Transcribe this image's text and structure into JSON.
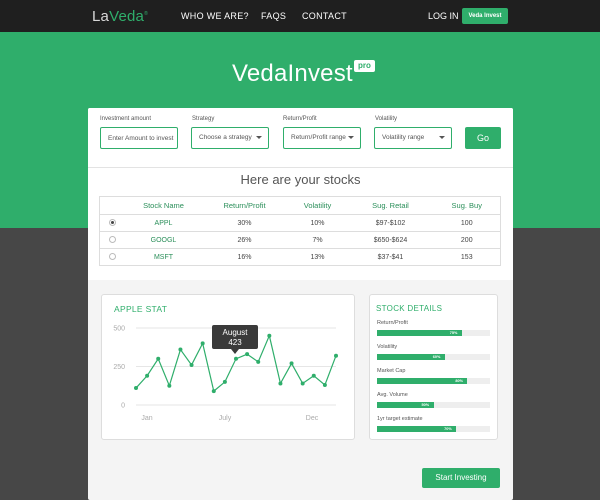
{
  "nav": {
    "logo_la": "La",
    "logo_veda": "Veda",
    "logo_tm": "®",
    "links": [
      "WHO WE ARE?",
      "FAQS",
      "CONTACT"
    ],
    "login": "LOG IN",
    "cta": "Veda Invest"
  },
  "hero": {
    "brand": "VedaInvest",
    "badge": "pro"
  },
  "filters": {
    "investment": {
      "label": "Investment amount",
      "placeholder": "Enter Amount to invest"
    },
    "strategy": {
      "label": "Strategy",
      "value": "Choose a strategy"
    },
    "return": {
      "label": "Return/Profit",
      "value": "Return/Profit range"
    },
    "volatility": {
      "label": "Volatility",
      "value": "Volatility range"
    },
    "go": "Go"
  },
  "stocks": {
    "title": "Here are your stocks",
    "headers": [
      "Stock Name",
      "Return/Profit",
      "Volatility",
      "Sug. Retail",
      "Sug. Buy"
    ],
    "rows": [
      {
        "name": "APPL",
        "ret": "30%",
        "vol": "10%",
        "retail": "$97-$102",
        "buy": "100",
        "selected": true
      },
      {
        "name": "GOOGL",
        "ret": "26%",
        "vol": "7%",
        "retail": "$650-$624",
        "buy": "200",
        "selected": false
      },
      {
        "name": "MSFT",
        "ret": "16%",
        "vol": "13%",
        "retail": "$37-$41",
        "buy": "153",
        "selected": false
      }
    ]
  },
  "stat": {
    "title": "APPLE STAT",
    "tooltip_label": "August",
    "tooltip_value": "423"
  },
  "chart_data": {
    "type": "line",
    "title": "APPLE STAT",
    "y_ticks": [
      "500",
      "250",
      "0"
    ],
    "x_ticks": [
      "Jan",
      "July",
      "Dec"
    ],
    "ylim": [
      0,
      500
    ],
    "values": [
      110,
      190,
      300,
      125,
      360,
      260,
      400,
      90,
      150,
      300,
      330,
      280,
      450,
      140,
      270,
      140,
      190,
      130,
      320
    ],
    "highlight": {
      "label": "August",
      "value": 423
    },
    "color": "#2fae6b",
    "grid": true
  },
  "details": {
    "title": "STOCK DETAILS",
    "items": [
      {
        "label": "Return/Profit",
        "pct": "75%",
        "fill": 0.75
      },
      {
        "label": "Volatility",
        "pct": "60%",
        "fill": 0.6
      },
      {
        "label": "Market Cap",
        "pct": "80%",
        "fill": 0.8
      },
      {
        "label": "Avg. Volume",
        "pct": "50%",
        "fill": 0.5
      },
      {
        "label": "1yr target estimate",
        "pct": "70%",
        "fill": 0.7
      }
    ]
  },
  "start_button": "Start Investing",
  "colors": {
    "accent": "#2fae6b",
    "dark": "#1f1f1f",
    "background": "#474747"
  }
}
